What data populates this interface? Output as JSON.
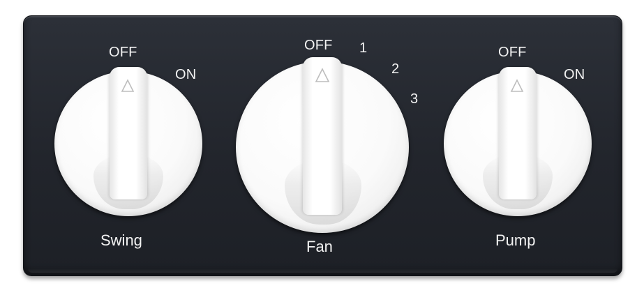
{
  "panel": {
    "knobs": [
      {
        "name": "Swing",
        "positions": [
          "OFF",
          "ON"
        ],
        "selected": "OFF"
      },
      {
        "name": "Fan",
        "positions": [
          "OFF",
          "1",
          "2",
          "3"
        ],
        "selected": "OFF"
      },
      {
        "name": "Pump",
        "positions": [
          "OFF",
          "ON"
        ],
        "selected": "OFF"
      }
    ]
  },
  "colors": {
    "panel": "#24272e",
    "knob": "#ffffff",
    "label": "#f2f2f2"
  },
  "icons": {
    "pointer": "triangle-pointer-icon"
  }
}
